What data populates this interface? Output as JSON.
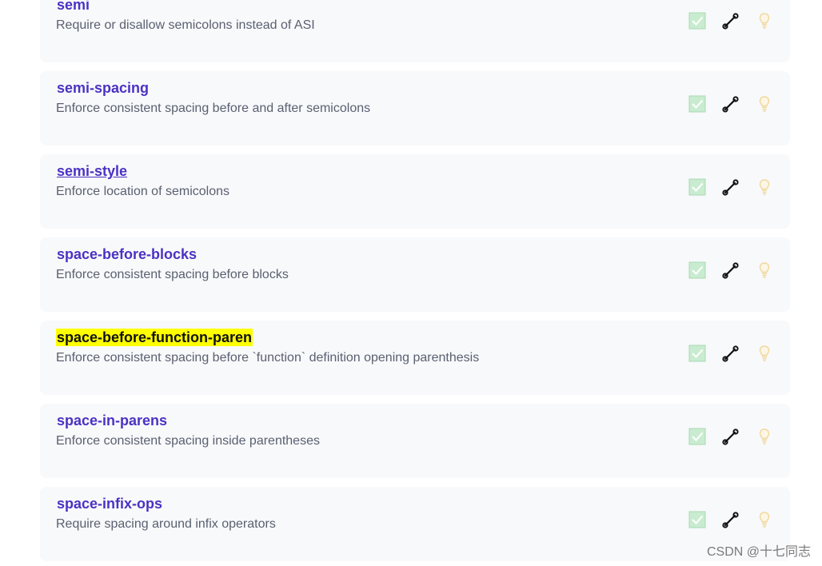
{
  "rules": [
    {
      "name": "semi",
      "description": "Require or disallow semicolons instead of ASI",
      "style": "normal",
      "icons": [
        "recommended-check-icon",
        "fixable-wrench-icon",
        "suggestion-bulb-icon"
      ]
    },
    {
      "name": "semi-spacing",
      "description": "Enforce consistent spacing before and after semicolons",
      "style": "normal",
      "icons": [
        "recommended-check-icon",
        "fixable-wrench-icon",
        "suggestion-bulb-icon"
      ]
    },
    {
      "name": "semi-style",
      "description": "Enforce location of semicolons",
      "style": "underlined",
      "icons": [
        "recommended-check-icon",
        "fixable-wrench-icon",
        "suggestion-bulb-icon"
      ]
    },
    {
      "name": "space-before-blocks",
      "description": "Enforce consistent spacing before blocks",
      "style": "normal",
      "icons": [
        "recommended-check-icon",
        "fixable-wrench-icon",
        "suggestion-bulb-icon"
      ]
    },
    {
      "name": "space-before-function-paren",
      "description": "Enforce consistent spacing before `function` definition opening parenthesis",
      "style": "highlighted",
      "icons": [
        "recommended-check-icon",
        "fixable-wrench-icon",
        "suggestion-bulb-icon"
      ]
    },
    {
      "name": "space-in-parens",
      "description": "Enforce consistent spacing inside parentheses",
      "style": "normal",
      "icons": [
        "recommended-check-icon",
        "fixable-wrench-icon",
        "suggestion-bulb-icon"
      ]
    },
    {
      "name": "space-infix-ops",
      "description": "Require spacing around infix operators",
      "style": "normal",
      "icons": [
        "recommended-check-icon",
        "fixable-wrench-icon",
        "suggestion-bulb-icon"
      ]
    }
  ],
  "colors": {
    "link": "#4b32c3",
    "highlight": "#ffff00",
    "description": "#5a6070",
    "card_bg": "#f8f9fb",
    "check_bg": "#c9ecd0",
    "bulb": "#f3deb0"
  },
  "watermark": "CSDN @十七同志"
}
